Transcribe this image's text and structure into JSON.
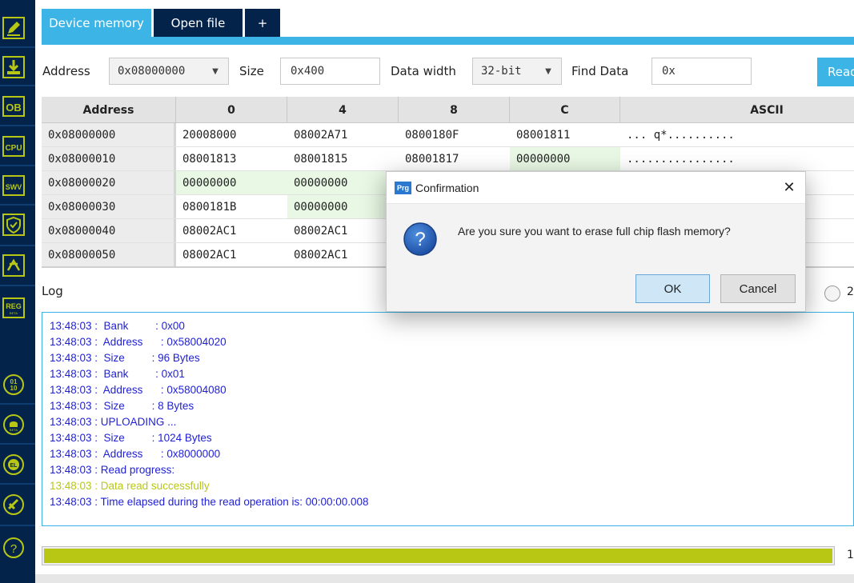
{
  "tabs": [
    {
      "label": "Device memory"
    },
    {
      "label": "Open file"
    },
    {
      "label": "+"
    }
  ],
  "toolbar": {
    "address_label": "Address",
    "address_value": "0x08000000",
    "size_label": "Size",
    "size_value": "0x400",
    "width_label": "Data width",
    "width_value": "32-bit",
    "find_label": "Find Data",
    "find_value": "0x",
    "read_label": "Read"
  },
  "memory": {
    "headers": [
      "Address",
      "0",
      "4",
      "8",
      "C",
      "ASCII"
    ],
    "rows": [
      [
        "0x08000000",
        "20008000",
        "08002A71",
        "0800180F",
        "08001811",
        "... q*.........."
      ],
      [
        "0x08000010",
        "08001813",
        "08001815",
        "08001817",
        "00000000",
        "................"
      ],
      [
        "0x08000020",
        "00000000",
        "00000000",
        "",
        "",
        ""
      ],
      [
        "0x08000030",
        "0800181B",
        "00000000",
        "",
        "",
        ""
      ],
      [
        "0x08000040",
        "08002AC1",
        "08002AC1",
        "",
        "",
        ""
      ],
      [
        "0x08000050",
        "08002AC1",
        "08002AC1",
        "",
        "",
        ""
      ]
    ]
  },
  "log": {
    "label": "Log",
    "lines": [
      "13:48:03 :  Bank         : 0x00",
      "13:48:03 :  Address      : 0x58004020",
      "13:48:03 :  Size         : 96 Bytes",
      "13:48:03 :  Bank         : 0x01",
      "13:48:03 :  Address      : 0x58004080",
      "13:48:03 :  Size         : 8 Bytes",
      "13:48:03 : UPLOADING ...",
      "13:48:03 :  Size         : 1024 Bytes",
      "13:48:03 :  Address      : 0x8000000",
      "13:48:03 : Read progress:",
      "13:48:03 : Data read successfully",
      "13:48:03 : Time elapsed during the read operation is: 00:00:00.008"
    ]
  },
  "radio_text": "2",
  "progress": {
    "fraction": 1.0,
    "text": "1"
  },
  "dialog": {
    "icon_text": "Prg",
    "title": "Confirmation",
    "close": "✕",
    "message": "Are you sure you want to erase full chip flash memory?",
    "ok": "OK",
    "cancel": "Cancel"
  },
  "sidebar": {
    "icons": [
      "edit-icon",
      "download-icon",
      "OB",
      "CPU",
      "SWV",
      "shield-icon",
      "star-icon",
      "REG",
      "binary-icon",
      "beta-icon",
      "el-icon",
      "fuse-icon",
      "help-icon"
    ],
    "text_icons": {
      "ob": "OB",
      "cpu": "CPU",
      "swv": "SWV",
      "reg": "REG",
      "reg_sub": "BETA",
      "bin1": "01",
      "bin2": "10",
      "beta": "BETA",
      "el": "EL",
      "help": "?"
    }
  },
  "colors": {
    "navy": "#03234b",
    "accent": "#3cb4e6",
    "success": "#b8c714",
    "log_text": "#1f1fd6"
  }
}
